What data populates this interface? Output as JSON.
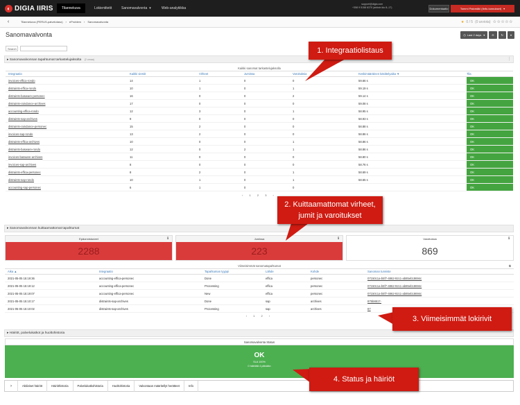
{
  "topbar": {
    "brand": "DIGIA IIRIS",
    "nav": [
      "Tilannekuva",
      "Lokientitetit",
      "Sanomavalvonta",
      "Web-analytiikka"
    ],
    "support_email": "support@digia.com",
    "support_phone": "+358 9 5158 6370 (arkisin klo 8–17)",
    "doc_button": "Dokumentaatio",
    "user_button": "Tommi Palomäki (tinfo-tunnukset)"
  },
  "breadcrumb": [
    "Tilannekuva (PERUS-palvelutaso)",
    "eProblem",
    "Sanomavalvonta"
  ],
  "rating": {
    "value": "0 / 5",
    "count": "(0 arviota)"
  },
  "page": {
    "title": "Sanomavalvonta",
    "time_range": "Last 2 days"
  },
  "search": {
    "label": "Search"
  },
  "section1": {
    "title": "Sanomavalvonnan tapahtumat tarkastelujaksolta",
    "sub": "(2 omaa)"
  },
  "table1": {
    "caption": "Kaikki sanomat tarkastelujaksolla",
    "headers": [
      "Integraatio",
      "Kaikki viestit",
      "Virheet",
      "Jumissa",
      "Varoituksia",
      "Keskimääräinen käsittelyaika ▼",
      "Tila"
    ],
    "rows": [
      [
        "invoices-effica-rondo",
        "14",
        "1",
        "0",
        "0",
        "59.66 s",
        "OK"
      ],
      [
        "distraints-effica-rondo",
        "10",
        "1",
        "0",
        "1",
        "59.19 s",
        "OK"
      ],
      [
        "distraints-basware-personec",
        "16",
        "0",
        "0",
        "2",
        "59.14 s",
        "OK"
      ],
      [
        "distraints-raindance-archives",
        "17",
        "0",
        "0",
        "0",
        "59.08 s",
        "OK"
      ],
      [
        "accounting-effica-rondo",
        "12",
        "3",
        "0",
        "1",
        "58.95 s",
        "OK"
      ],
      [
        "distraints-sap-archives",
        "9",
        "0",
        "0",
        "0",
        "58.93 s",
        "OK"
      ],
      [
        "distraints-raindance-personec",
        "15",
        "2",
        "0",
        "0",
        "58.88 s",
        "OK"
      ],
      [
        "invoices-sap-rondo",
        "13",
        "2",
        "0",
        "0",
        "58.86 s",
        "OK"
      ],
      [
        "distraints-effica-archives",
        "10",
        "0",
        "0",
        "1",
        "58.86 s",
        "OK"
      ],
      [
        "distraints-basware-rondo",
        "12",
        "0",
        "2",
        "1",
        "58.86 s",
        "OK"
      ],
      [
        "invoices-basware-archives",
        "11",
        "0",
        "0",
        "0",
        "58.80 s",
        "OK"
      ],
      [
        "invoices-sap-archives",
        "8",
        "0",
        "0",
        "0",
        "58.76 s",
        "OK"
      ],
      [
        "distraints-effica-personec",
        "8",
        "2",
        "0",
        "1",
        "58.69 s",
        "OK"
      ],
      [
        "distraints-sap-rondo",
        "10",
        "1",
        "0",
        "1",
        "58.65 s",
        "OK"
      ],
      [
        "accounting-sap-personec",
        "6",
        "1",
        "0",
        "0",
        "",
        "OK"
      ]
    ],
    "pager": "‹ 1 2 3 ›"
  },
  "section2": {
    "title": "Sanomavalvonnan kuittaamattomat tapahtumat"
  },
  "counters": [
    {
      "label": "Epäonnistuneet",
      "value": "2288"
    },
    {
      "label": "Jumissa",
      "value": "223"
    },
    {
      "label": "Varoituksia",
      "value": "869"
    }
  ],
  "table2": {
    "caption": "Viimeisimmät sanomatapahtumat",
    "headers": [
      "Aika ▲",
      "Integraatio",
      "Tapahtuman tyyppi",
      "Lähde",
      "Kohde",
      "Sanoman tunniste"
    ],
    "rows": [
      [
        "2021-05-05 15:19:36",
        "accounting-effica-personec",
        "Done",
        "effica",
        "personec",
        "07150c1a-b5f7-4862-92c1-ab85eb18694c"
      ],
      [
        "2021-05-05 15:19:12",
        "accounting-effica-personec",
        "Processing",
        "effica",
        "personec",
        "07150c1a-b5f7-4862-92c1-ab85eb18694c"
      ],
      [
        "2021-05-05 15:19:07",
        "accounting-effica-personec",
        "New",
        "effica",
        "personec",
        "07150c1a-b5f7-4862-92c1-ab85eb18694c"
      ],
      [
        "2021-05-05 15:10:17",
        "distraints-sap-archives",
        "Done",
        "sap",
        "archives",
        "875b8817-"
      ],
      [
        "2021-05-05 15:10:02",
        "distraints-sap-archives",
        "Processing",
        "sap",
        "archives",
        "87"
      ]
    ],
    "pager": "‹ 1 2 ›"
  },
  "section3": {
    "title": "Häiriöt, palvelukatkot ja huoltohistoria"
  },
  "status": {
    "title": "Sanomavalvonta Status",
    "value": "OK",
    "sla": "SLA 100%",
    "detail": "0 häiriötä 4 päivään"
  },
  "tabs": [
    "›",
    "Aktiiviset häiriöt",
    "Häiriöhistoria",
    "Palvelukatkohistoria",
    "Huoltohistoria",
    "Valvontaan määritellyt herätteet",
    "Info"
  ],
  "callouts": {
    "c1": "1. Integraatiolistaus",
    "c2a": "2. Kuittaamattomat virheet,",
    "c2b": "jumit ja varoitukset",
    "c3": "3. Viimeisimmät lokirivit",
    "c4": "4. Status ja häiriöt"
  },
  "colors": {
    "ok_green": "#44a540",
    "error_red": "#d93b3b",
    "brand_red": "#d8302a",
    "topbar": "#1e1e1e"
  }
}
